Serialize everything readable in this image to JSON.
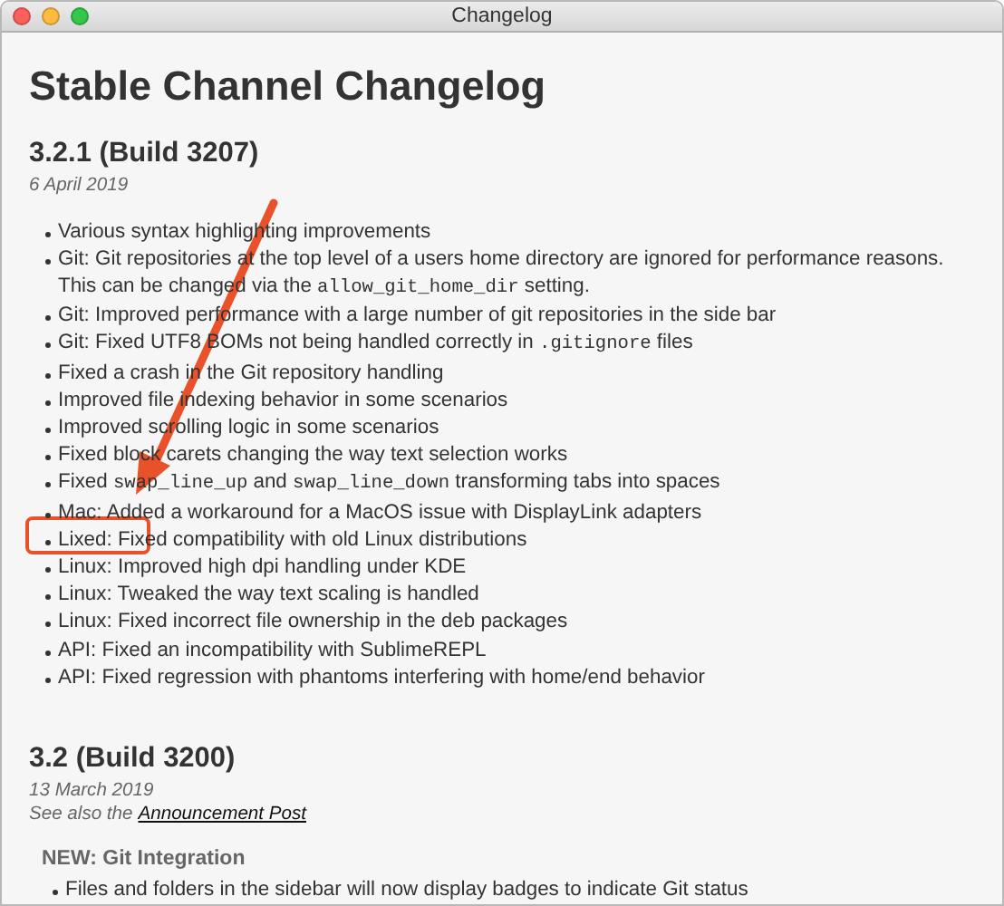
{
  "window": {
    "title": "Changelog"
  },
  "page_title": "Stable Channel Changelog",
  "releases": [
    {
      "heading": "3.2.1 (Build 3207)",
      "date": "6 April 2019",
      "items": [
        [
          {
            "kind": "text",
            "text": "Various syntax highlighting improvements"
          }
        ],
        [
          {
            "kind": "text",
            "text": "Git: Git repositories at the top level of a users home directory are ignored for performance reasons. This can be changed via the "
          },
          {
            "kind": "code",
            "text": "allow_git_home_dir"
          },
          {
            "kind": "text",
            "text": " setting."
          }
        ],
        [
          {
            "kind": "text",
            "text": "Git: Improved performance with a large number of git repositories in the side bar"
          }
        ],
        [
          {
            "kind": "text",
            "text": "Git: Fixed UTF8 BOMs not being handled correctly in "
          },
          {
            "kind": "code",
            "text": ".gitignore"
          },
          {
            "kind": "text",
            "text": " files"
          }
        ],
        [
          {
            "kind": "text",
            "text": "Fixed a crash in the Git repository handling"
          }
        ],
        [
          {
            "kind": "text",
            "text": "Improved file indexing behavior in some scenarios"
          }
        ],
        [
          {
            "kind": "text",
            "text": "Improved scrolling logic in some scenarios"
          }
        ],
        [
          {
            "kind": "text",
            "text": "Fixed block carets changing the way text selection works"
          }
        ],
        [
          {
            "kind": "text",
            "text": "Fixed "
          },
          {
            "kind": "code",
            "text": "swap_line_up"
          },
          {
            "kind": "text",
            "text": " and "
          },
          {
            "kind": "code",
            "text": "swap_line_down"
          },
          {
            "kind": "text",
            "text": " transforming tabs into spaces"
          }
        ],
        [
          {
            "kind": "text",
            "text": "Mac: Added a workaround for a MacOS issue with DisplayLink adapters"
          }
        ],
        [
          {
            "kind": "text",
            "text": "Lixed: Fixed compatibility with old Linux distributions"
          }
        ],
        [
          {
            "kind": "text",
            "text": "Linux: Improved high dpi handling under KDE"
          }
        ],
        [
          {
            "kind": "text",
            "text": "Linux: Tweaked the way text scaling is handled"
          }
        ],
        [
          {
            "kind": "text",
            "text": "Linux: Fixed incorrect file ownership in the deb packages"
          }
        ],
        [
          {
            "kind": "text",
            "text": "API: Fixed an incompatibility with SublimeREPL"
          }
        ],
        [
          {
            "kind": "text",
            "text": "API: Fixed regression with phantoms interfering with home/end behavior"
          }
        ]
      ]
    },
    {
      "heading": "3.2 (Build 3200)",
      "date": "13 March 2019",
      "see_also": {
        "text": "See also the",
        "link": "Announcement Post"
      },
      "sections": [
        {
          "title": "NEW: Git Integration",
          "items": [
            [
              {
                "kind": "text",
                "text": "Files and folders in the sidebar will now display badges to indicate Git status"
              }
            ]
          ]
        }
      ]
    }
  ],
  "annotation": {
    "kind": "arrow_and_box",
    "color": "#e8512a"
  }
}
